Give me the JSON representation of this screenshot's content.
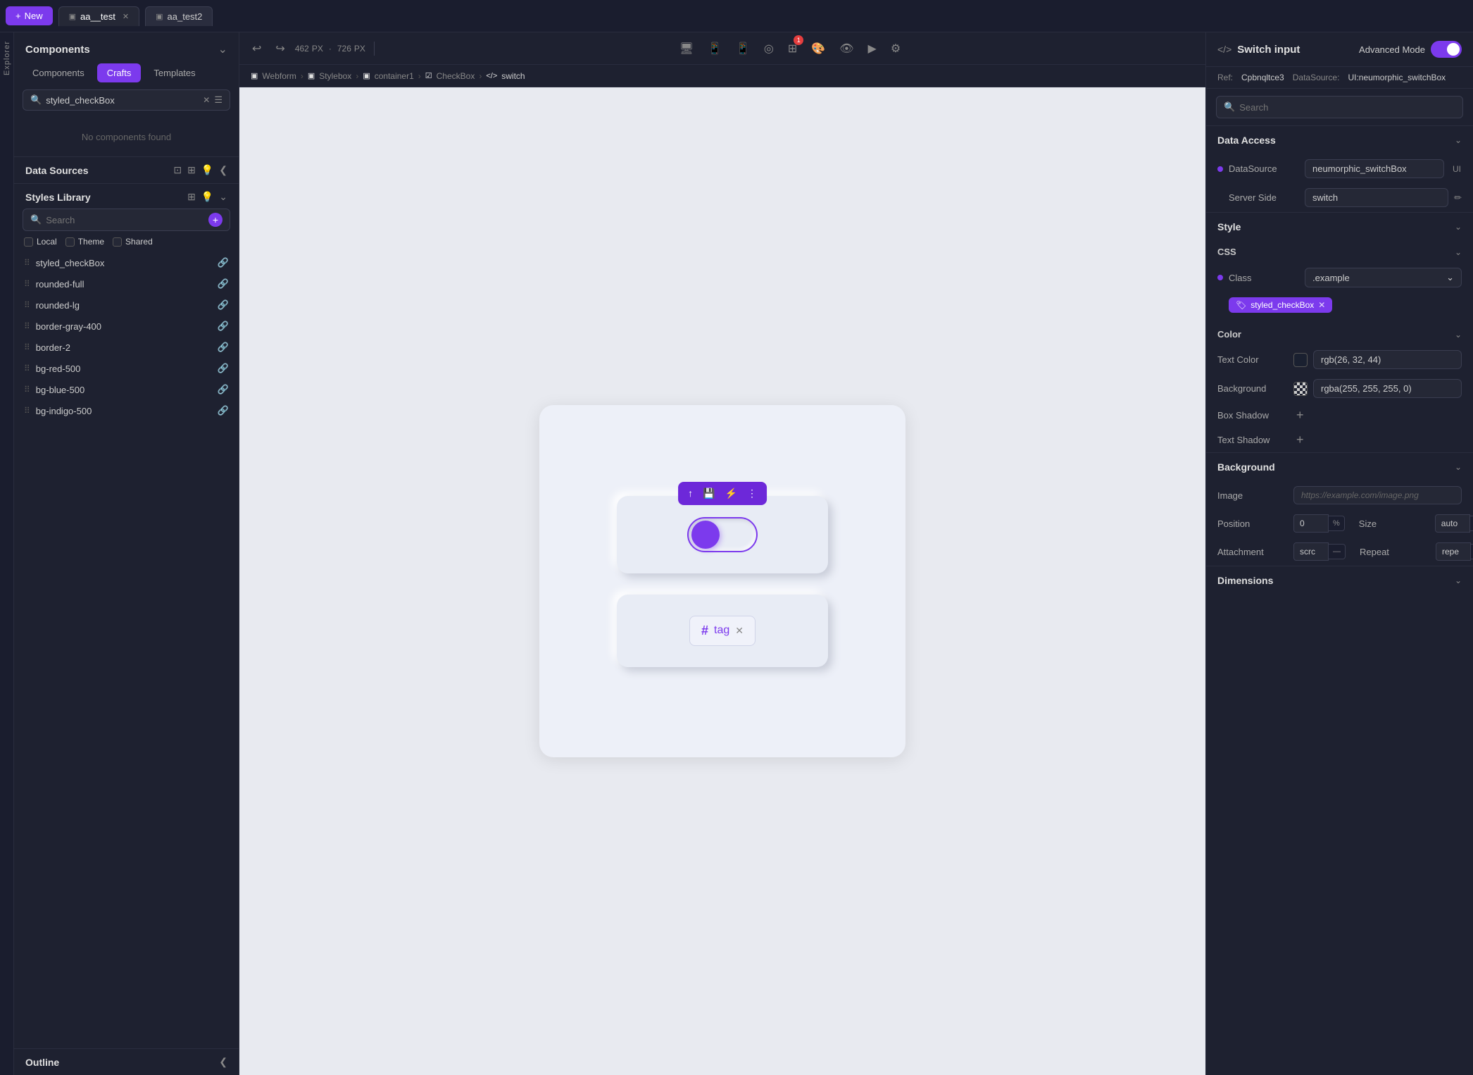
{
  "topbar": {
    "new_label": "New",
    "tabs": [
      {
        "id": "tab1",
        "label": "aa__test",
        "icon": "▣"
      },
      {
        "id": "tab2",
        "label": "aa_test2",
        "icon": "▣"
      }
    ]
  },
  "left_panel": {
    "title": "Components",
    "sub_tabs": [
      "Components",
      "Crafts",
      "Templates"
    ],
    "active_sub_tab": "Crafts",
    "search": {
      "value": "styled_checkBox",
      "placeholder": "Search"
    },
    "no_components_message": "No components found",
    "data_sources_title": "Data Sources",
    "styles_library": {
      "title": "Styles Library",
      "search_placeholder": "Search",
      "filters": [
        "Local",
        "Theme",
        "Shared"
      ],
      "items": [
        "styled_checkBox",
        "rounded-full",
        "rounded-lg",
        "border-gray-400",
        "border-2",
        "bg-red-500",
        "bg-blue-500",
        "bg-indigo-500"
      ]
    },
    "outline_title": "Outline"
  },
  "toolbar": {
    "coords": {
      "x": "462",
      "y": "726",
      "unit": "PX"
    }
  },
  "breadcrumb": {
    "items": [
      "Webform",
      "Stylebox",
      "container1",
      "CheckBox",
      "switch"
    ]
  },
  "right_panel": {
    "title": "Switch input",
    "advanced_mode_label": "Advanced Mode",
    "ref": "Cpbnqltce3",
    "datasource": "UI:neumorphic_switchBox",
    "search_placeholder": "Search",
    "data_access": {
      "title": "Data Access",
      "datasource_label": "DataSource",
      "datasource_value": "neumorphic_switchBox",
      "datasource_suffix": "UI",
      "server_side_label": "Server Side",
      "server_side_value": "switch"
    },
    "style": {
      "title": "Style",
      "css_title": "CSS",
      "class_label": "Class",
      "class_value": ".example",
      "class_tag": "styled_checkBox",
      "color": {
        "title": "Color",
        "text_color_label": "Text Color",
        "text_color_value": "rgb(26, 32, 44)",
        "background_label": "Background",
        "background_value": "rgba(255, 255, 255, 0)",
        "box_shadow_label": "Box Shadow",
        "text_shadow_label": "Text Shadow"
      }
    },
    "background": {
      "title": "Background",
      "image_label": "Image",
      "image_placeholder": "https://example.com/image.png",
      "position_label": "Position",
      "position_value": "0",
      "position_unit": "%",
      "size_label": "Size",
      "size_value": "auto",
      "attachment_label": "Attachment",
      "attachment_value": "scrc",
      "repeat_label": "Repeat",
      "repeat_value": "repe"
    },
    "dimensions": {
      "title": "Dimensions"
    }
  }
}
